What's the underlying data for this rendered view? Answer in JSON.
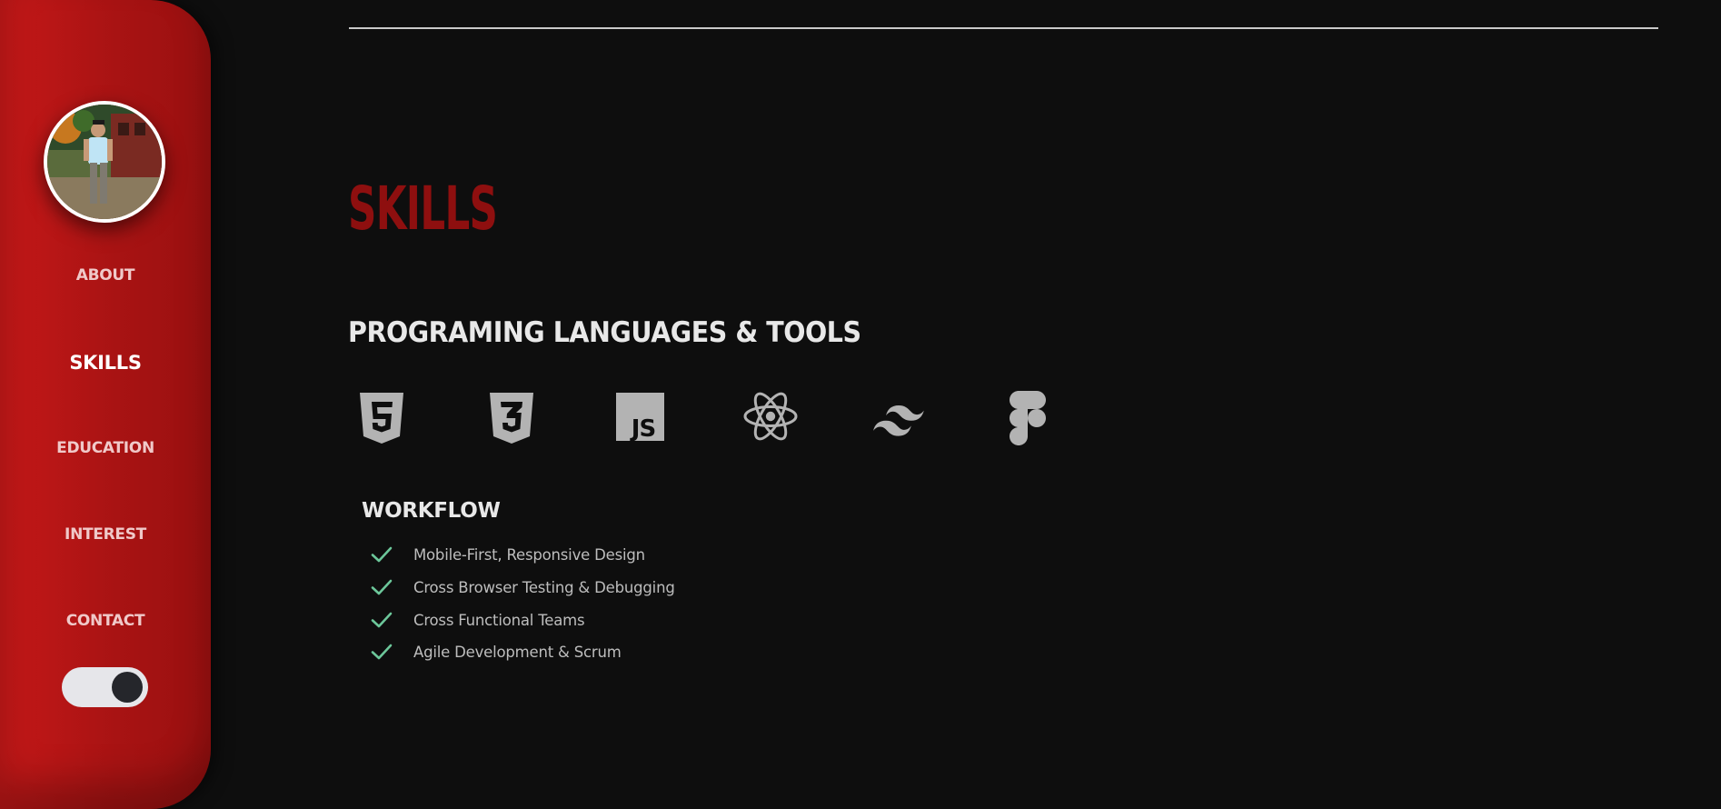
{
  "sidebar": {
    "avatar_alt": "profile photo",
    "nav": [
      {
        "label": "ABOUT",
        "active": false
      },
      {
        "label": "SKILLS",
        "active": true
      },
      {
        "label": "EDUCATION",
        "active": false
      },
      {
        "label": "INTEREST",
        "active": false
      },
      {
        "label": "CONTACT",
        "active": false
      }
    ],
    "theme_toggle": {
      "state": "on"
    }
  },
  "main": {
    "section_title": "SKILLS",
    "tools_heading": "PROGRAMING LANGUAGES & TOOLS",
    "tools": [
      {
        "icon": "html5-icon"
      },
      {
        "icon": "css3-icon"
      },
      {
        "icon": "javascript-icon",
        "text": "JS"
      },
      {
        "icon": "react-icon"
      },
      {
        "icon": "tailwind-icon"
      },
      {
        "icon": "figma-icon"
      }
    ],
    "workflow_heading": "WORKFLOW",
    "workflow": [
      "Mobile-First, Responsive Design",
      "Cross Browser Testing & Debugging",
      "Cross Functional Teams",
      "Agile Development & Scrum"
    ]
  },
  "colors": {
    "background": "#0e0e0e",
    "sidebar": "#b01414",
    "accent_title": "#8e0f0f",
    "icon_gray": "#b3b3b3",
    "check_green": "#6cc79a"
  }
}
